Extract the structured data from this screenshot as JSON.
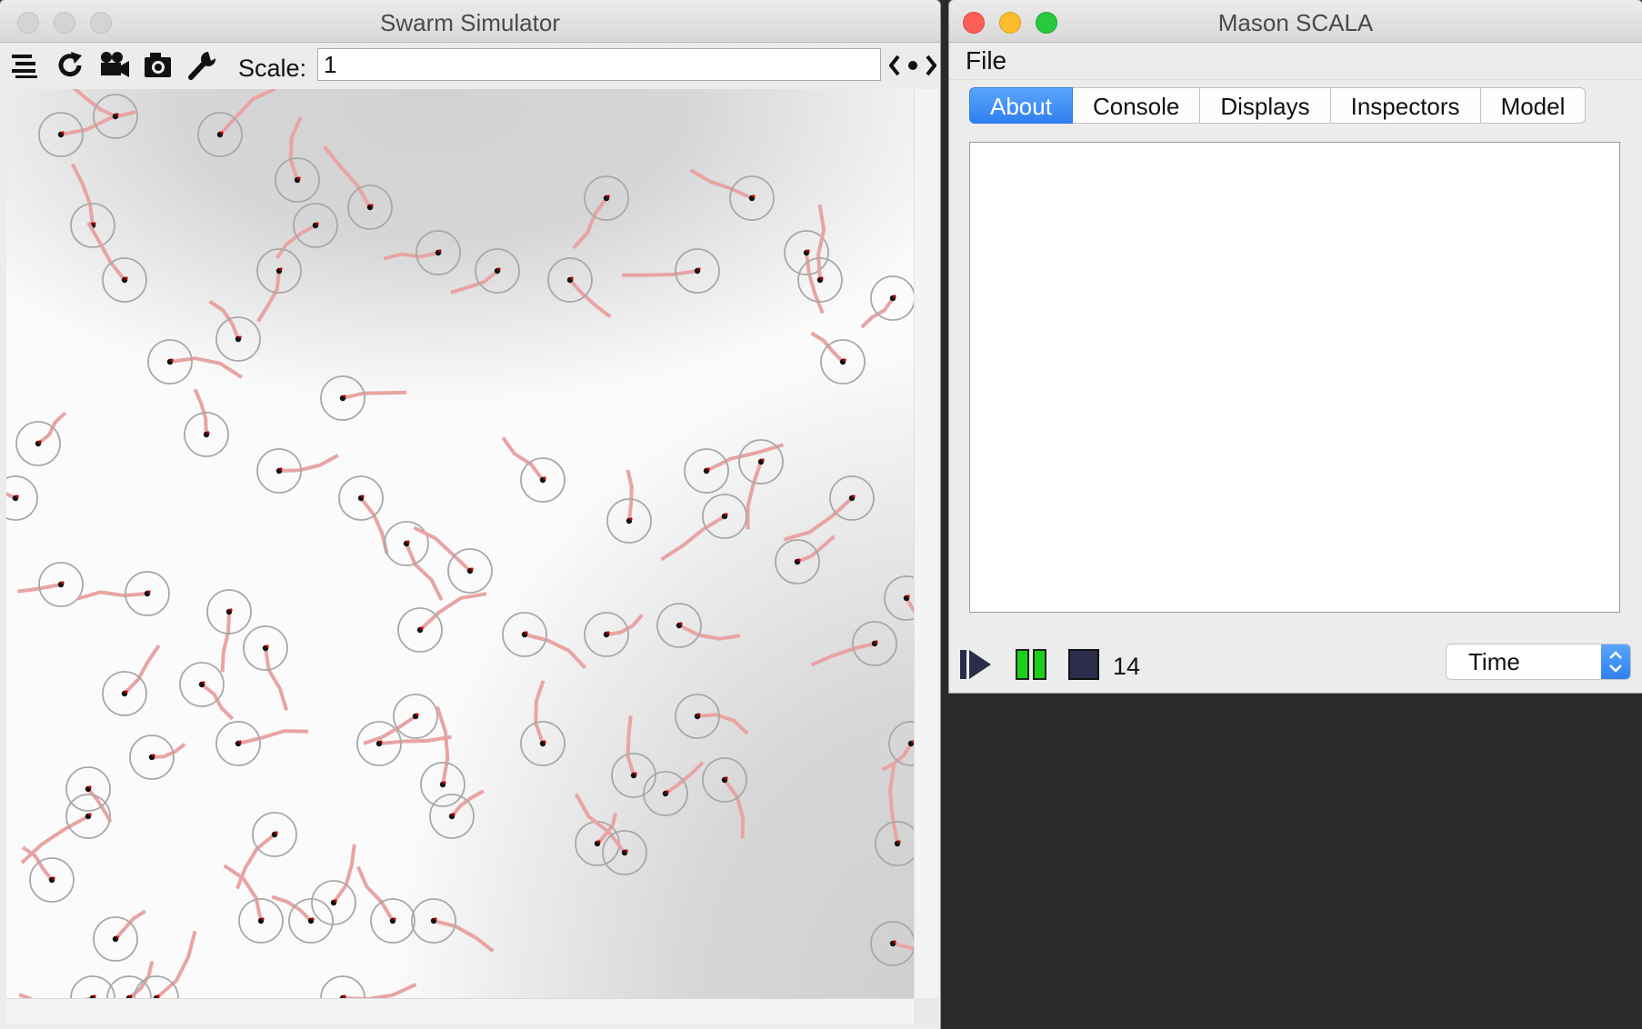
{
  "swarm_window": {
    "title": "Swarm Simulator",
    "toolbar": {
      "layers_icon": "layers-icon",
      "refresh_icon": "refresh-icon",
      "movie_icon": "movie-camera-icon",
      "snapshot_icon": "camera-icon",
      "options_icon": "wrench-icon",
      "scale_label": "Scale:",
      "scale_value": "1",
      "nav_icon": "arrows-left-right-icon"
    },
    "agent_color": "#e8a4a4",
    "agent_dot_color": "#cc0000",
    "sensor_ring_color": "#a8a8a8"
  },
  "mason_window": {
    "title": "Mason SCALA",
    "menu": {
      "file": "File"
    },
    "tabs": [
      {
        "label": "About",
        "active": true
      },
      {
        "label": "Console",
        "active": false
      },
      {
        "label": "Displays",
        "active": false
      },
      {
        "label": "Inspectors",
        "active": false
      },
      {
        "label": "Model",
        "active": false
      }
    ],
    "controls": {
      "play_icon": "play-icon",
      "pause_icon": "pause-icon",
      "stop_icon": "stop-icon",
      "step_count": "14",
      "time_select": "Time"
    },
    "accent_color": "#2f7ff0",
    "pause_color": "#19d119"
  }
}
